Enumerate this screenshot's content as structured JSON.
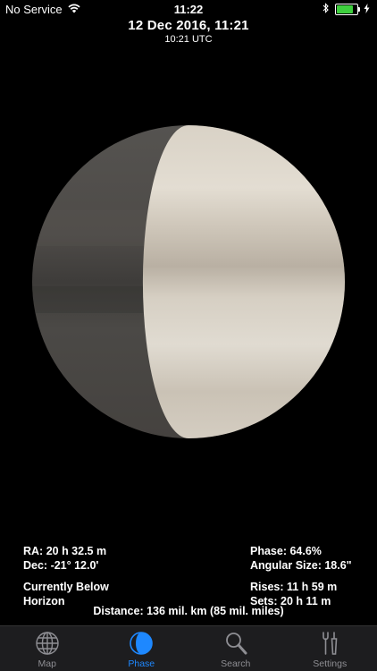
{
  "status_bar": {
    "carrier": "No Service",
    "time": "11:22",
    "battery_level": 0.85,
    "battery_color": "#3ecf3e"
  },
  "header": {
    "local_datetime": "12 Dec 2016, 11:21",
    "utc_time": "10:21 UTC"
  },
  "planet": {
    "phase_fraction": 0.646,
    "lit_color": "#d8d2c6",
    "dark_color": "#4a4846"
  },
  "info_left": {
    "ra": "RA: 20 h 32.5 m",
    "dec": "Dec: -21° 12.0'",
    "visibility_line1": "Currently Below",
    "visibility_line2": "Horizon"
  },
  "info_right": {
    "phase": "Phase: 64.6%",
    "angular_size": "Angular Size: 18.6\"",
    "rises": "Rises: 11 h 59 m",
    "sets": "Sets: 20 h 11 m"
  },
  "distance": "Distance: 136 mil. km (85 mil. miles)",
  "tabs": [
    {
      "label": "Map",
      "icon": "globe-icon",
      "active": false
    },
    {
      "label": "Phase",
      "icon": "phase-icon",
      "active": true
    },
    {
      "label": "Search",
      "icon": "search-icon",
      "active": false
    },
    {
      "label": "Settings",
      "icon": "tools-icon",
      "active": false
    }
  ],
  "colors": {
    "accent": "#1e88ff",
    "inactive_tab": "#8e8e93",
    "tabbar_bg": "#1d1d1f"
  }
}
